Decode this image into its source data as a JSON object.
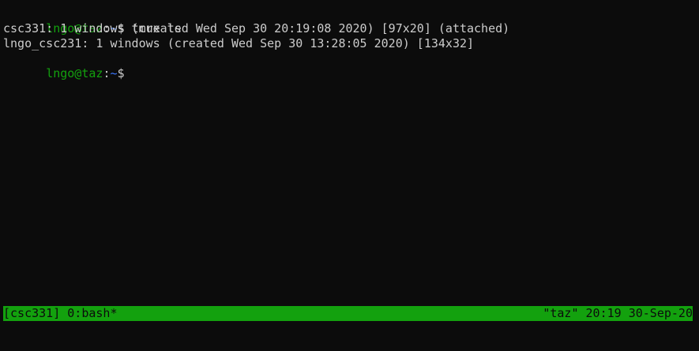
{
  "colors": {
    "background": "#0c0c0c",
    "foreground": "#cccccc",
    "prompt_green": "#13a10e",
    "prompt_blue": "#3b78ff",
    "status_bg": "#13a10e",
    "status_fg": "#0c0c0c"
  },
  "terminal": {
    "lines": [
      {
        "prompt_user_host": "lngo@taz",
        "prompt_colon": ":",
        "prompt_path": "~",
        "prompt_symbol": "$",
        "command": " tmux ls"
      },
      {
        "text": "csc331: 1 windows (created Wed Sep 30 20:19:08 2020) [97x20] (attached)"
      },
      {
        "text": "lngo_csc231: 1 windows (created Wed Sep 30 13:28:05 2020) [134x32]"
      },
      {
        "prompt_user_host": "lngo@taz",
        "prompt_colon": ":",
        "prompt_path": "~",
        "prompt_symbol": "$",
        "command": ""
      }
    ]
  },
  "statusbar": {
    "left": "[csc331] 0:bash*",
    "right": "\"taz\" 20:19 30-Sep-20"
  }
}
